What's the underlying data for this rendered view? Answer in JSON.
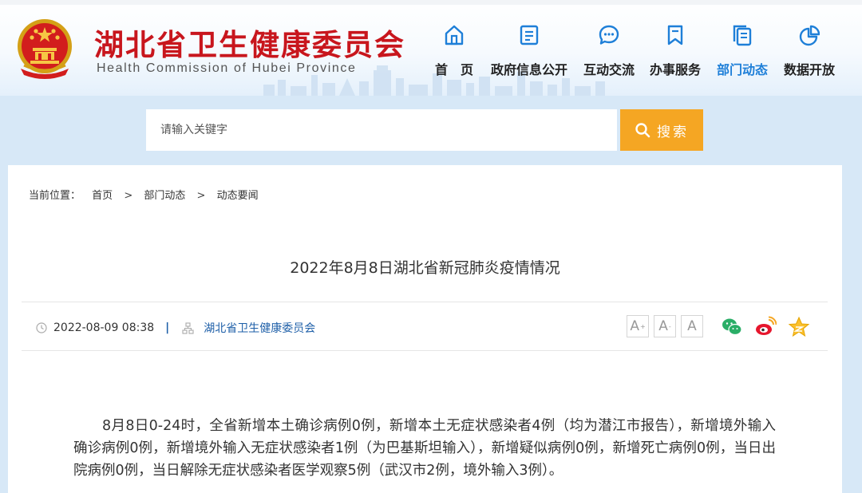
{
  "header": {
    "title": "湖北省卫生健康委员会",
    "subtitle": "Health Commission of Hubei Province"
  },
  "nav": [
    {
      "label": "首　页",
      "icon": "home-icon"
    },
    {
      "label": "政府信息公开",
      "icon": "document-list-icon"
    },
    {
      "label": "互动交流",
      "icon": "chat-bubble-icon"
    },
    {
      "label": "办事服务",
      "icon": "bookmark-icon"
    },
    {
      "label": "部门动态",
      "icon": "document-copy-icon",
      "active": true
    },
    {
      "label": "数据开放",
      "icon": "pie-chart-icon"
    }
  ],
  "search": {
    "placeholder": "请输入关键字",
    "button_label": "搜索"
  },
  "breadcrumb": {
    "prefix": "当前位置：",
    "items": [
      "首页",
      "部门动态",
      "动态要闻"
    ],
    "separator": ">"
  },
  "article": {
    "title": "2022年8月8日湖北省新冠肺炎疫情情况",
    "date": "2022-08-09 08:38",
    "divider": "|",
    "source": "湖北省卫生健康委员会",
    "body": "8月8日0-24时，全省新增本土确诊病例0例，新增本土无症状感染者4例（均为潜江市报告），新增境外输入确诊病例0例，新增境外输入无症状感染者1例（为巴基斯坦输入），新增疑似病例0例，新增死亡病例0例，当日出院病例0例，当日解除无症状感染者医学观察5例（武汉市2例，境外输入3例）。"
  },
  "font_size_buttons": [
    {
      "label": "A",
      "mark": "+"
    },
    {
      "label": "A",
      "mark": "-"
    },
    {
      "label": "A",
      "mark": ""
    }
  ],
  "share_icons": [
    "wechat-icon",
    "weibo-icon",
    "favorite-star-icon"
  ],
  "colors": {
    "brand_red": "#c8161d",
    "accent_blue": "#1e7fd8",
    "search_orange": "#f5a623",
    "page_bg": "#d7e8f7"
  }
}
